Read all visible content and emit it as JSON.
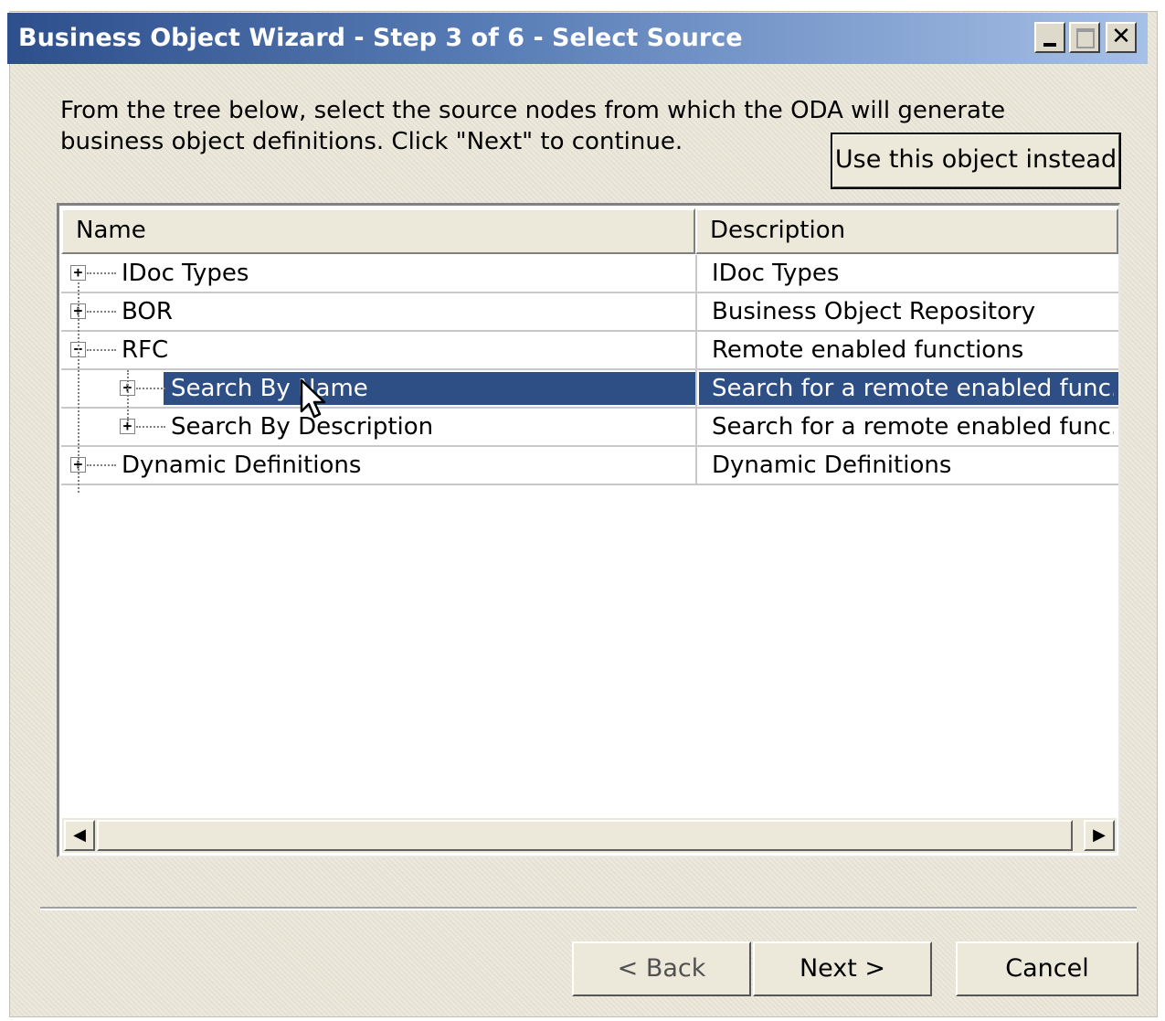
{
  "window": {
    "title": "Business Object Wizard - Step 3 of 6 - Select Source",
    "minimize_icon": "minimize-icon",
    "maximize_icon": "maximize-icon",
    "close_glyph": "✕",
    "close_icon": "close-icon"
  },
  "instructions": "From the tree below, select the source nodes from which the ODA will generate business object definitions. Click \"Next\" to continue.",
  "use_object_button": "Use this object instead",
  "tree": {
    "columns": {
      "name": "Name",
      "description": "Description"
    },
    "rows": [
      {
        "name": "IDoc Types",
        "description": "IDoc Types",
        "expander": "+",
        "level": 0,
        "selected": false
      },
      {
        "name": "BOR",
        "description": "Business Object Repository",
        "expander": "+",
        "level": 0,
        "selected": false
      },
      {
        "name": "RFC",
        "description": "Remote enabled functions",
        "expander": "−",
        "level": 0,
        "selected": false
      },
      {
        "name": "Search By Name",
        "description": "Search for a remote enabled func...",
        "expander": "+",
        "level": 1,
        "selected": true
      },
      {
        "name": "Search By Description",
        "description": "Search for a remote enabled func...",
        "expander": "+",
        "level": 1,
        "selected": false
      },
      {
        "name": "Dynamic Definitions",
        "description": "Dynamic Definitions",
        "expander": "+",
        "level": 0,
        "selected": false
      }
    ]
  },
  "scrollbar": {
    "left_arrow": "◀",
    "right_arrow": "▶"
  },
  "footer": {
    "back": "< Back",
    "next": "Next >",
    "cancel": "Cancel"
  },
  "colors": {
    "title_gradient_start": "#2d4f8c",
    "selection": "#2e4f86",
    "dialog_bg": "#ece8da"
  }
}
